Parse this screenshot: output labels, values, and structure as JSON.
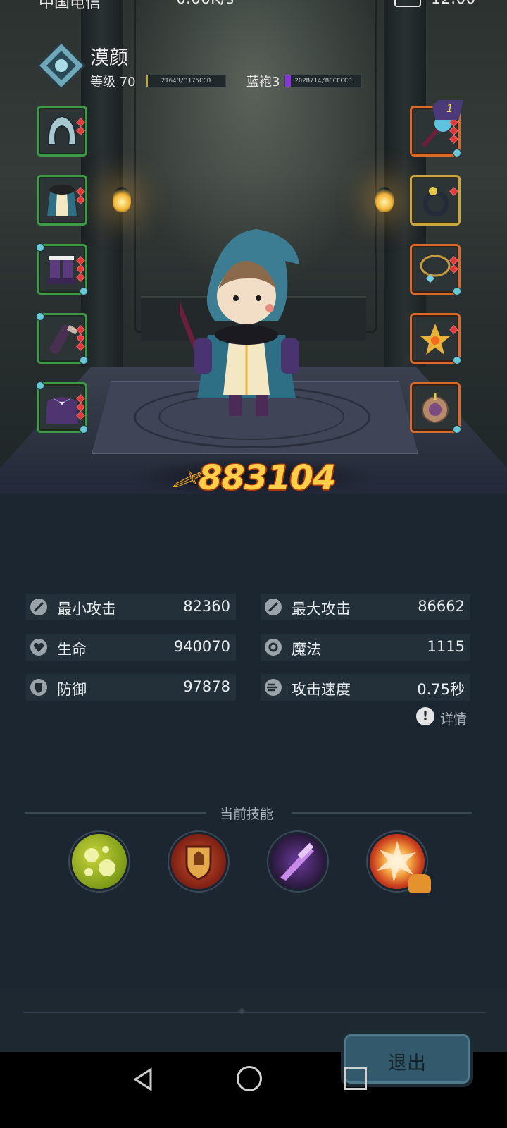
{
  "status_bar": {
    "carrier": "中国电信",
    "speed": "0.00K/s",
    "time": "12:00"
  },
  "player": {
    "name": "漠颜",
    "level_label": "等级 70",
    "exp_text": "21648/3175CCO",
    "rank_label": "蓝袍3",
    "rank_text": "2028714/8CCCCCO"
  },
  "equipment": {
    "left": [
      "hood-icon",
      "robe-icon",
      "boots-icon",
      "gloves-icon",
      "cape-icon"
    ],
    "right": [
      "staff-icon",
      "ring-icon",
      "necklace-icon",
      "relic-icon",
      "orb-icon"
    ],
    "weapon_badge": "1"
  },
  "power": {
    "value": "883104",
    "icon": "sword-icon"
  },
  "stats": [
    {
      "label": "最小攻击",
      "value": "82360",
      "icon": "sword-icon"
    },
    {
      "label": "最大攻击",
      "value": "86662",
      "icon": "sword-icon"
    },
    {
      "label": "生命",
      "value": "940070",
      "icon": "heart-icon"
    },
    {
      "label": "魔法",
      "value": "1115",
      "icon": "magic-icon"
    },
    {
      "label": "防御",
      "value": "97878",
      "icon": "shield-icon"
    },
    {
      "label": "攻击速度",
      "value": "0.75秒",
      "icon": "speed-icon"
    }
  ],
  "details_label": "详情",
  "skills": {
    "title": "当前技能",
    "items": [
      "poison-bubbles-icon",
      "shield-crest-icon",
      "shadow-blade-icon",
      "explosion-icon"
    ]
  },
  "exit_label": "退出",
  "colors": {
    "power": "#ffcf4a",
    "stat_row_bg": "#23303a",
    "page_bg": "#1c2631",
    "exit_button": "#335a6c"
  }
}
